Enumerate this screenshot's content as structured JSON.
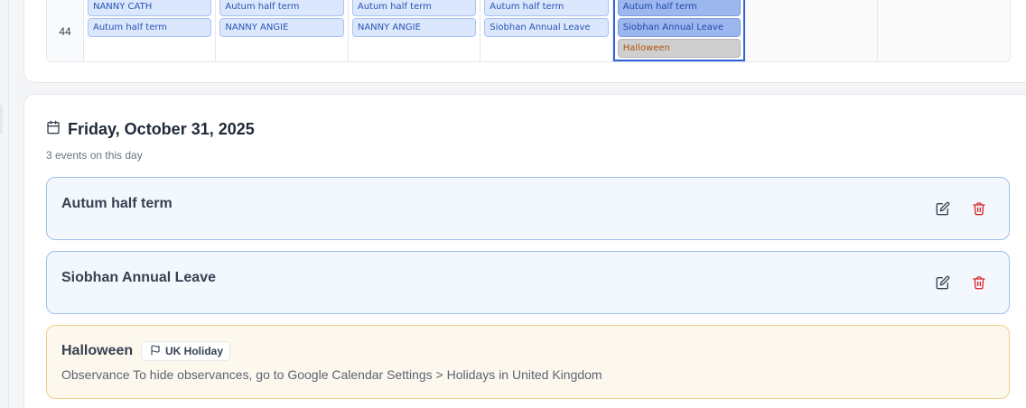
{
  "calendar": {
    "week_number": "44",
    "days": [
      {
        "events": [
          "NANNY CATH",
          "Autum half term"
        ]
      },
      {
        "events": [
          "Autum half term",
          "NANNY ANGIE"
        ]
      },
      {
        "events": [
          "Autum half term",
          "NANNY ANGIE"
        ]
      },
      {
        "events": [
          "Autum half term",
          "Siobhan Annual Leave"
        ]
      },
      {
        "events": [
          "Autum half term",
          "Siobhan Annual Leave",
          "Halloween"
        ],
        "selected": true
      },
      {
        "events": []
      },
      {
        "events": []
      }
    ]
  },
  "day_detail": {
    "title": "Friday, October 31, 2025",
    "subtitle": "3 events on this day",
    "events": [
      {
        "title": "Autum half term"
      },
      {
        "title": "Siobhan Annual Leave"
      },
      {
        "title": "Halloween",
        "badge": "UK Holiday",
        "description": "Observance To hide observances, go to Google Calendar Settings > Holidays in United Kingdom"
      }
    ]
  },
  "colors": {
    "event_bg": "#f3f7fe",
    "event_border": "#9dc0ec",
    "holiday_bg": "#fdf8ee",
    "holiday_border": "#f0cf8a",
    "delete_red": "#dc2626",
    "today_outline": "#2f62d8"
  },
  "icons": {
    "header": "calendar-icon",
    "edit": "edit-icon",
    "delete": "trash-icon",
    "badge": "flag-icon"
  }
}
